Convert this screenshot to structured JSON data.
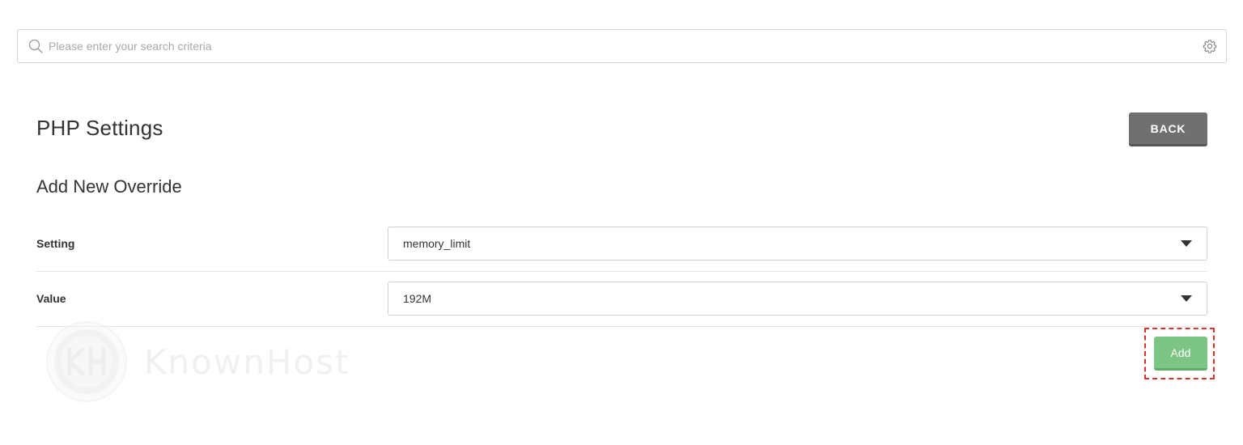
{
  "search": {
    "placeholder": "Please enter your search criteria",
    "icon": "search-icon",
    "settings_icon": "gear-icon"
  },
  "header": {
    "title": "PHP Settings",
    "back_label": "BACK"
  },
  "form": {
    "section_title": "Add New Override",
    "fields": [
      {
        "label": "Setting",
        "value": "memory_limit"
      },
      {
        "label": "Value",
        "value": "192M"
      }
    ],
    "add_label": "Add"
  },
  "watermark": {
    "text": "KnownHost"
  },
  "colors": {
    "back_button": "#707070",
    "add_button": "#7dc585",
    "highlight": "#e0302b"
  }
}
